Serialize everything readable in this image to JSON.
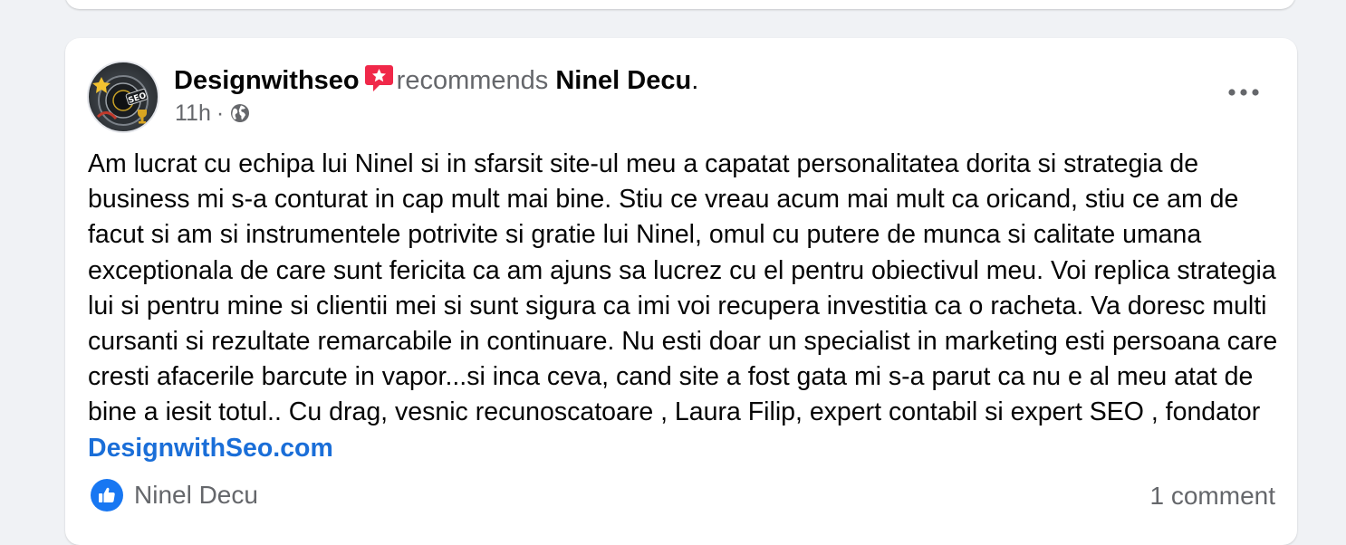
{
  "post": {
    "author": "Designwithseo",
    "action_text": "recommends",
    "target": "Ninel Decu",
    "period": ".",
    "time": "11h",
    "separator": "·",
    "body_text": "Am lucrat cu echipa lui Ninel si in sfarsit site-ul meu a capatat personalitatea dorita si strategia de business mi s-a conturat in cap mult mai bine. Stiu ce vreau acum mai mult ca oricand, stiu ce am de facut si am si instrumentele potrivite si gratie lui Ninel, omul cu putere de munca si calitate umana exceptionala de care sunt fericita ca am ajuns sa lucrez cu el pentru obiectivul meu. Voi replica strategia lui si pentru mine si clientii mei si sunt sigura ca imi voi recupera investitia ca o racheta. Va doresc multi cursanti si rezultate remarcabile in continuare. Nu esti doar un specialist in marketing esti persoana care cresti afacerile barcute in vapor...si inca ceva, cand site a fost gata mi s-a parut ca nu e al meu atat de bine a iesit totul.. Cu drag, vesnic recunoscatoare , Laura Filip, expert contabil si expert SEO , fondator ",
    "body_link": "DesignwithSeo.com",
    "avatar_text": "SEO",
    "icons": {
      "recommend": "recommend-star-icon",
      "audience": "globe-icon",
      "more": "more-options-icon",
      "reaction": "like-icon"
    }
  },
  "footer": {
    "reaction_name": "Ninel Decu",
    "comments": "1 comment"
  },
  "colors": {
    "page_background": "#f0f2f5",
    "card_background": "#ffffff",
    "link": "#1a6ed8",
    "muted": "#65676b",
    "like_blue": "#1877f2",
    "recommend_red": "#f02849"
  }
}
